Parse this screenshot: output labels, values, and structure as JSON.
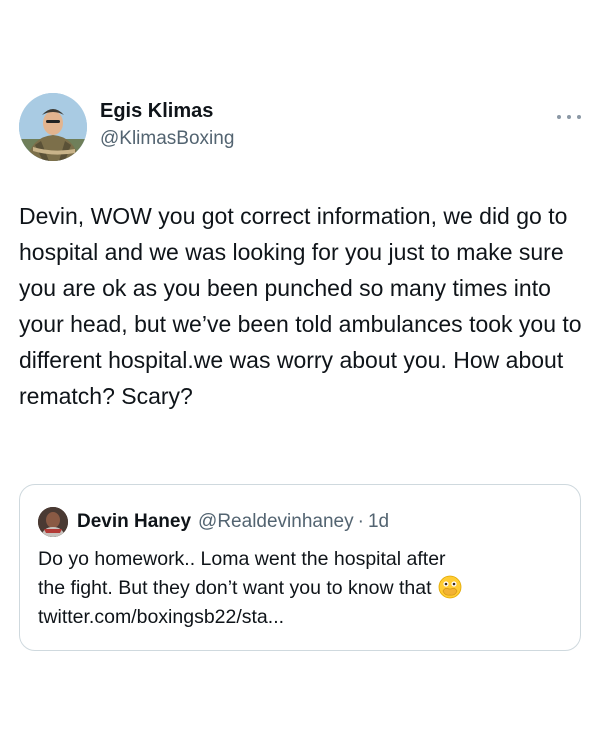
{
  "author": {
    "display_name": "Egis Klimas",
    "handle": "@KlimasBoxing"
  },
  "tweet": {
    "text": "Devin, WOW you got correct information, we did go to hospital and we was looking for you just to make sure you are ok as you been punched so many times into your head, but we’ve been told ambulances took you to different hospital.we was worry about you. How about rematch? Scary?"
  },
  "quoted_tweet": {
    "display_name": "Devin Haney",
    "handle": "@Realdevinhaney",
    "separator": "·",
    "time": "1d",
    "text_line1": "Do yo homework.. Loma went the hospital after",
    "text_line2": "the fight. But they don’t want you to know that",
    "link": "twitter.com/boxingsb22/sta...",
    "emoji_icon": "face-with-open-eyes-and-hand-over-mouth-icon"
  },
  "colors": {
    "text_primary": "#0f1419",
    "text_secondary": "#536471",
    "border": "#cfd9de"
  },
  "icons": {
    "more": "more-horizontal-icon"
  }
}
